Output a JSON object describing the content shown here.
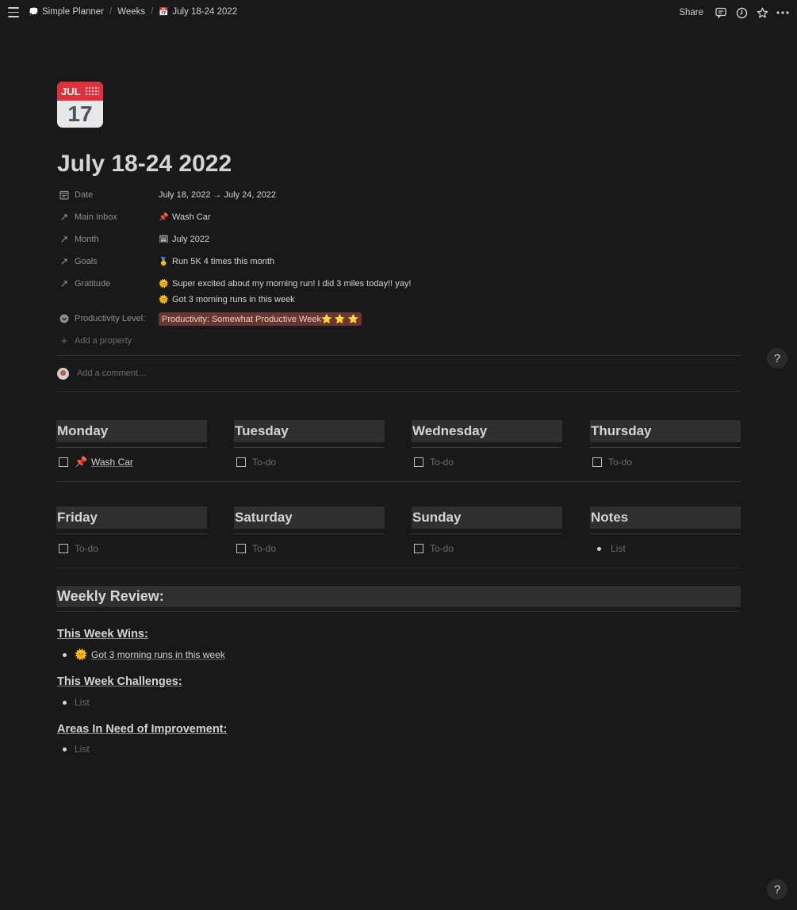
{
  "breadcrumb": {
    "workspace": "Simple Planner",
    "parent": "Weeks",
    "current": "July 18-24 2022"
  },
  "topbar": {
    "share": "Share"
  },
  "page": {
    "icon_month": "JUL",
    "icon_day": "17",
    "title": "July 18-24 2022"
  },
  "properties": {
    "date": {
      "name": "Date",
      "value": "July 18, 2022 → July 24, 2022"
    },
    "main_inbox": {
      "name": "Main Inbox",
      "value": "Wash Car"
    },
    "month": {
      "name": "Month",
      "value": "July 2022"
    },
    "goals": {
      "name": "Goals",
      "value": "Run 5K 4 times this month"
    },
    "gratitude": {
      "name": "Gratitude",
      "values": [
        "Super excited about my morning run! I did 3 miles today!! yay!",
        "Got 3 morning runs in this week"
      ]
    },
    "productivity": {
      "name": "Productivity Level:",
      "value": "Productivity: Somewhat Productive Week⭐️ ⭐️ ⭐️"
    },
    "add_property": "Add a property"
  },
  "comment": {
    "placeholder": "Add a comment…"
  },
  "days": [
    {
      "name": "Monday",
      "item": "Wash Car"
    },
    {
      "name": "Tuesday",
      "item": "To-do"
    },
    {
      "name": "Wednesday",
      "item": "To-do"
    },
    {
      "name": "Thursday",
      "item": "To-do"
    },
    {
      "name": "Friday",
      "item": "To-do"
    },
    {
      "name": "Saturday",
      "item": "To-do"
    },
    {
      "name": "Sunday",
      "item": "To-do"
    },
    {
      "name": "Notes",
      "item": "List"
    }
  ],
  "review": {
    "heading": "Weekly Review:",
    "wins_title": "This Week Wins:",
    "wins_item": "Got 3 morning runs in this week",
    "challenges_title": "This Week Challenges:",
    "challenges_item": "List",
    "improve_title": "Areas In Need of Improvement:",
    "improve_item": "List"
  },
  "help": "?"
}
